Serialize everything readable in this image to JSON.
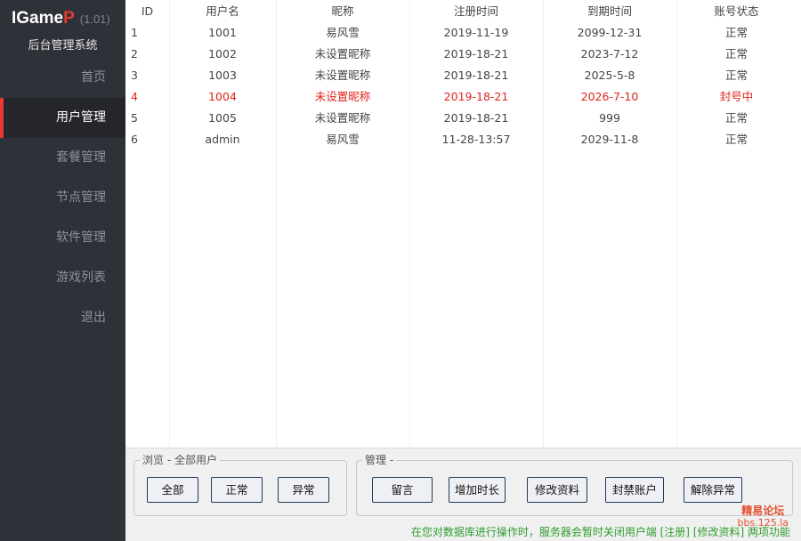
{
  "app": {
    "logo_text": "IGame",
    "logo_accent": "P",
    "version": "(1.01)",
    "subtitle": "后台管理系统"
  },
  "sidebar": {
    "items": [
      {
        "label": "首页",
        "active": false
      },
      {
        "label": "用户管理",
        "active": true
      },
      {
        "label": "套餐管理",
        "active": false
      },
      {
        "label": "节点管理",
        "active": false
      },
      {
        "label": "软件管理",
        "active": false
      },
      {
        "label": "游戏列表",
        "active": false
      },
      {
        "label": "退出",
        "active": false
      }
    ]
  },
  "table": {
    "columns": [
      "ID",
      "用户名",
      "昵称",
      "注册时间",
      "到期时间",
      "账号状态"
    ],
    "rows": [
      {
        "id": "1",
        "username": "1001",
        "nickname": "易风雪",
        "registered": "2019-11-19",
        "expires": "2099-12-31",
        "status": "正常",
        "highlight": false
      },
      {
        "id": "2",
        "username": "1002",
        "nickname": "未设置昵称",
        "registered": "2019-18-21",
        "expires": "2023-7-12",
        "status": "正常",
        "highlight": false
      },
      {
        "id": "3",
        "username": "1003",
        "nickname": "未设置昵称",
        "registered": "2019-18-21",
        "expires": "2025-5-8",
        "status": "正常",
        "highlight": false
      },
      {
        "id": "4",
        "username": "1004",
        "nickname": "未设置昵称",
        "registered": "2019-18-21",
        "expires": "2026-7-10",
        "status": "封号中",
        "highlight": true
      },
      {
        "id": "5",
        "username": "1005",
        "nickname": "未设置昵称",
        "registered": "2019-18-21",
        "expires": "999",
        "status": "正常",
        "highlight": false
      },
      {
        "id": "6",
        "username": "admin",
        "nickname": "易风雪",
        "registered": "11-28-13:57",
        "expires": "2029-11-8",
        "status": "正常",
        "highlight": false
      }
    ]
  },
  "browse": {
    "title": "浏览 - 全部用户",
    "buttons": [
      "全部",
      "正常",
      "异常"
    ]
  },
  "manage": {
    "title": "管理 -",
    "buttons": [
      "留言",
      "增加时长",
      "修改资料",
      "封禁账户",
      "解除异常"
    ]
  },
  "notice": "在您对数据库进行操作时，服务器会暂时关闭用户端 [注册] [修改资料] 两项功能",
  "watermark": {
    "line1": "精易论坛",
    "line2": "bbs.125.la"
  },
  "colors": {
    "sidebar_bg": "#2f3138",
    "accent": "#e53b2c",
    "danger_text": "#e0231b",
    "notice_text": "#2f9d2f"
  }
}
